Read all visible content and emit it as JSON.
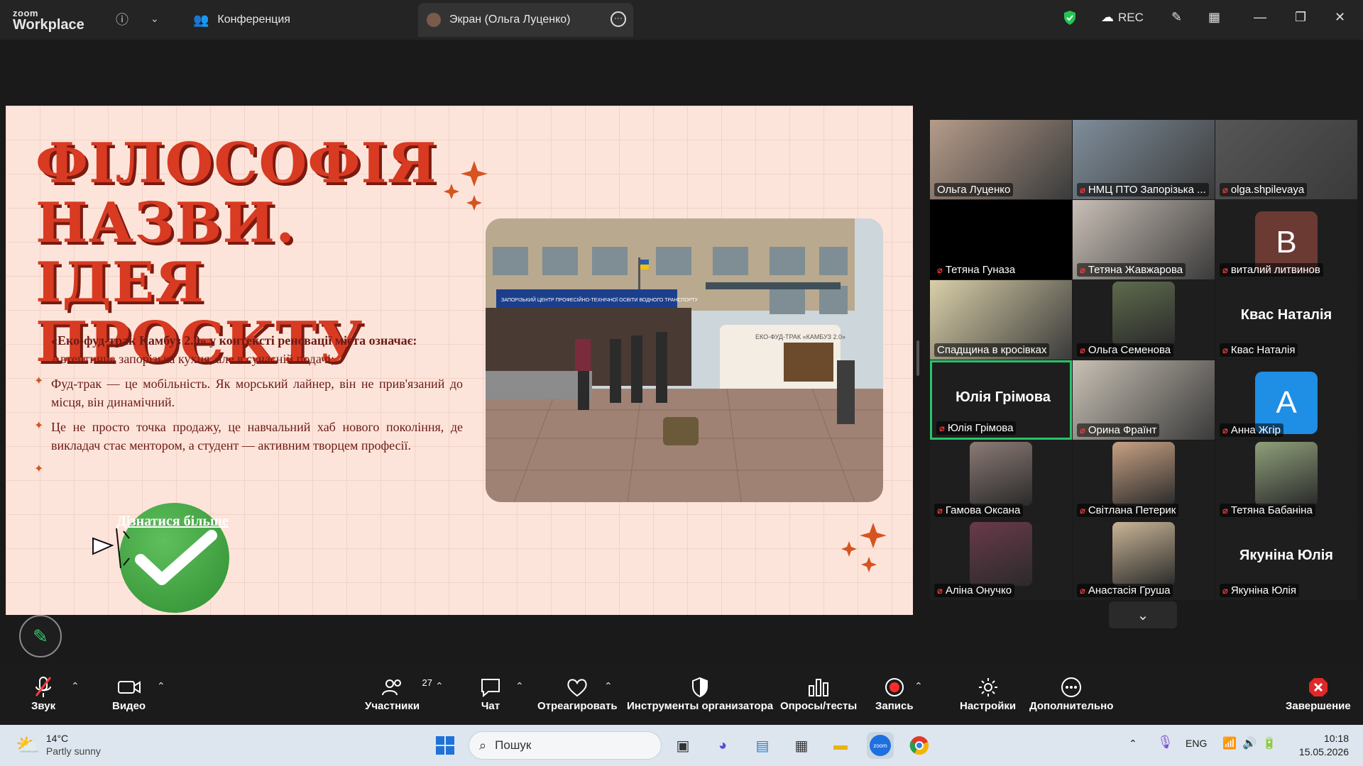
{
  "app": {
    "logo_line1": "zoom",
    "logo_line2": "Workplace"
  },
  "titlebar": {
    "tab_conference": "Конференция",
    "tab_screen": "Экран (Ольга Луценко)",
    "rec": "REC"
  },
  "slide": {
    "title_lines": [
      "ФІЛОСОФІЯ",
      "НАЗВИ. ІДЕЯ",
      "ПРОЄКТУ"
    ],
    "lead": "«Еко-фуд-трак Камбуз 2.0» у контексті реновації міста означає:",
    "paragraphs": [
      "Автентична запорізька кухня, але в сучасній подачі;",
      "Фуд-трак — це мобільність. Як морський лайнер, він не прив'язаний до місця, він динамічний.",
      "Це не просто точка продажу, це навчальний хаб нового покоління, де викладач стає ментором, а студент — активним творцем професії."
    ],
    "cta": "Дізнатися більше",
    "photo_sign": "ЗАПОРІЗЬКИЙ ЦЕНТР ПРОФЕСІЙНО-ТЕХНІЧНОЇ ОСВІТИ ВОДНОГО ТРАНСПОРТУ",
    "truck_text": "ЕКО-ФУД-ТРАК «КАМБУЗ 2.0»",
    "accent_color": "#d83a22"
  },
  "gallery": [
    {
      "name": "Ольга Луценко",
      "muted": false,
      "kind": "video",
      "color": "#b59c8a"
    },
    {
      "name": "НМЦ ПТО Запорізька ...",
      "muted": true,
      "kind": "video",
      "color": "#7f8e9b"
    },
    {
      "name": "olga.shpilevaya",
      "muted": true,
      "kind": "video",
      "color": "#565656"
    },
    {
      "name": "Тетяна Гуназа",
      "muted": true,
      "kind": "black",
      "color": "#000000"
    },
    {
      "name": "Тетяна Жавжарова",
      "muted": true,
      "kind": "video",
      "color": "#c9bfb6"
    },
    {
      "name": "виталий литвинов",
      "muted": true,
      "kind": "letter",
      "letter": "В",
      "color": "#6b3a33"
    },
    {
      "name": "Спадщина в кросівках",
      "muted": false,
      "kind": "video",
      "color": "#d9cfa8"
    },
    {
      "name": "Ольга Семенова",
      "muted": true,
      "kind": "photo",
      "color": "#5e6b4d"
    },
    {
      "name": "Квас Наталія",
      "muted": true,
      "kind": "bigname",
      "color": "#1e1e1e"
    },
    {
      "name": "Юлія Грімова",
      "muted": true,
      "kind": "bigname",
      "color": "#1e1e1e"
    },
    {
      "name": "Орина Фраїнт",
      "muted": true,
      "kind": "video",
      "color": "#c8c0b4"
    },
    {
      "name": "Анна Жгір",
      "muted": true,
      "kind": "letter",
      "letter": "А",
      "color": "#1f8ee5"
    },
    {
      "name": "Гамова Оксана",
      "muted": true,
      "kind": "photo",
      "color": "#8b7a75"
    },
    {
      "name": "Світлана Петерик",
      "muted": true,
      "kind": "photo",
      "color": "#c7a183"
    },
    {
      "name": "Тетяна Бабаніна",
      "muted": true,
      "kind": "photo",
      "color": "#8fa07a"
    },
    {
      "name": "Аліна Онучко",
      "muted": true,
      "kind": "photo",
      "color": "#6a3a4a"
    },
    {
      "name": "Анастасія Груша",
      "muted": true,
      "kind": "photo",
      "color": "#c9b596"
    },
    {
      "name": "Якуніна Юлія",
      "muted": true,
      "kind": "bigname",
      "color": "#1e1e1e"
    }
  ],
  "toolbar": {
    "audio": "Звук",
    "video": "Видео",
    "participants": "Участники",
    "participants_count": "27",
    "chat": "Чат",
    "react": "Отреагировать",
    "host_tools": "Инструменты организатора",
    "polls": "Опросы/тесты",
    "record": "Запись",
    "settings": "Настройки",
    "more": "Дополнительно",
    "end": "Завершение"
  },
  "taskbar": {
    "weather_temp": "14°C",
    "weather_desc": "Partly sunny",
    "search_placeholder": "Пошук",
    "lang": "ENG",
    "time": "10:18",
    "date": "15.05.2026"
  }
}
